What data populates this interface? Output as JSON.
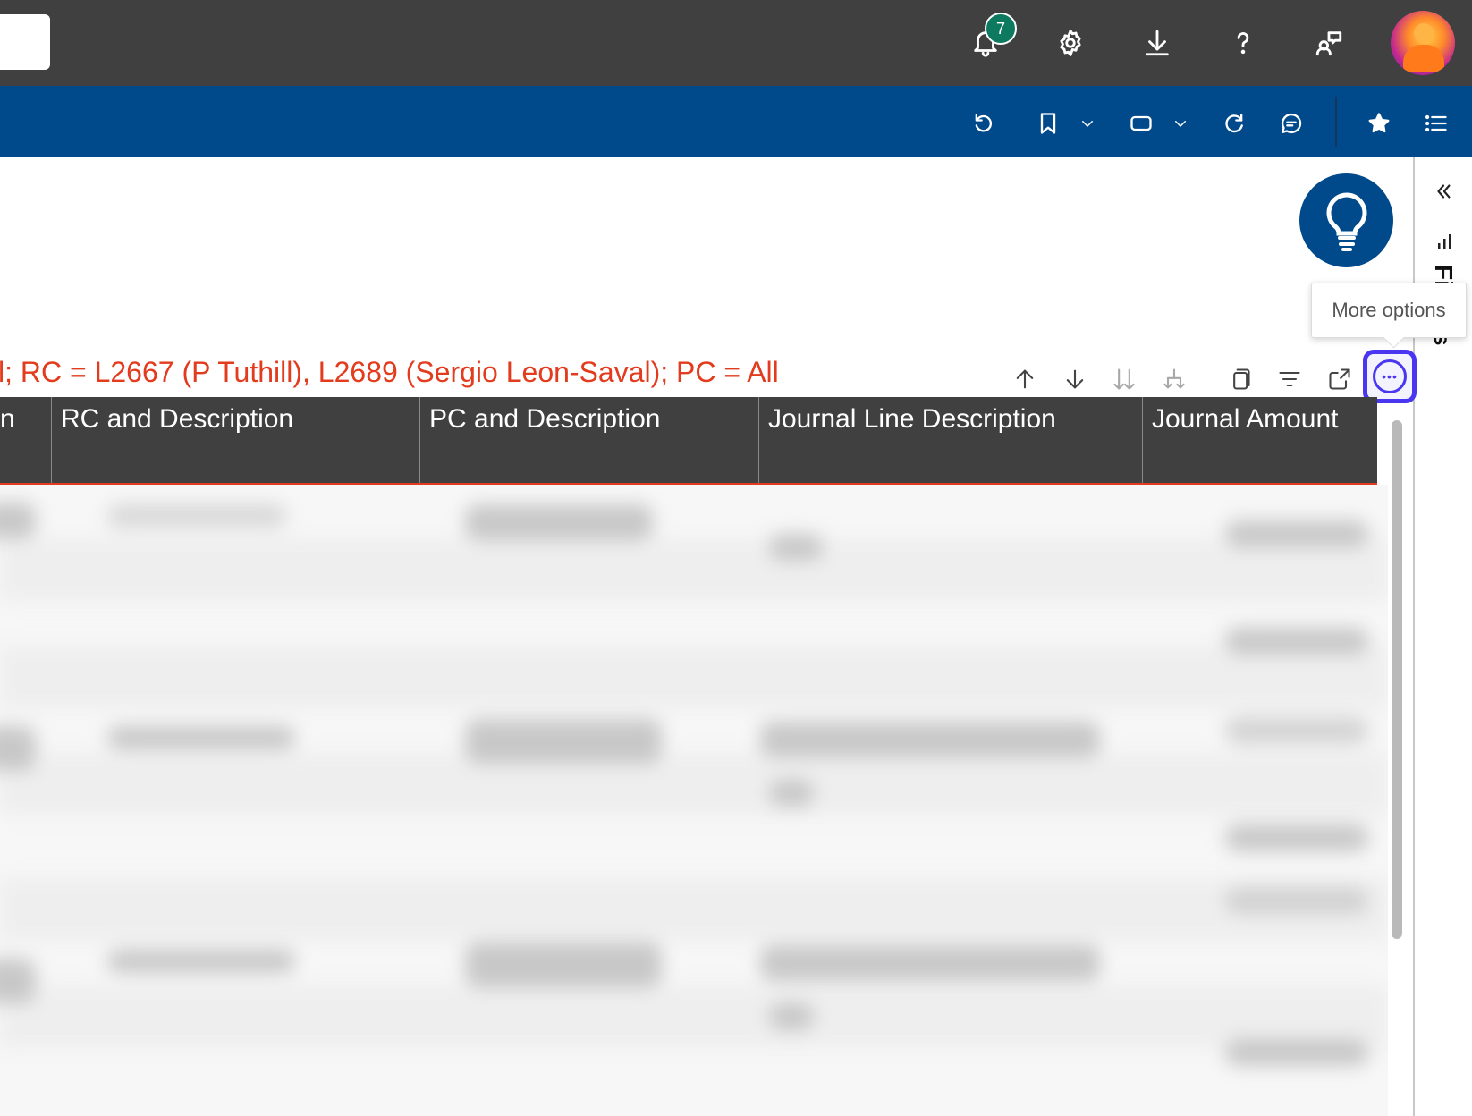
{
  "header": {
    "notifications_count": "7",
    "icons": [
      "bell-icon",
      "gear-icon",
      "download-icon",
      "help-icon",
      "feedback-icon",
      "avatar"
    ]
  },
  "toolbar": {
    "icons": [
      "reset-icon",
      "bookmark-icon",
      "chevron-down-icon",
      "view-icon",
      "chevron-down-icon",
      "refresh-icon",
      "comment-icon",
      "star-icon",
      "list-icon"
    ]
  },
  "side_panel": {
    "label_fragment": "Fi",
    "label_fragment_2": "s"
  },
  "tooltip": {
    "text": "More options"
  },
  "visual": {
    "filter_text": "l; RC = L2667 (P Tuthill), L2689 (Sergio Leon-Saval); PC = All",
    "toolbar_icons": [
      "sort-up-icon",
      "sort-down-icon",
      "expand-all-icon",
      "drill-icon",
      "copy-icon",
      "filter-icon",
      "focus-mode-icon",
      "more-options-icon"
    ],
    "more_options_glyph": "•••"
  },
  "table": {
    "columns": [
      "n",
      "RC and Description",
      "PC and Description",
      "Journal Line Description",
      "Journal Amount"
    ]
  },
  "colors": {
    "header_dark": "#404040",
    "toolbar_blue": "#004a8c",
    "filter_red": "#e23b1d",
    "badge_green": "#0d7a5f",
    "focus_purple": "#4a36f0"
  }
}
